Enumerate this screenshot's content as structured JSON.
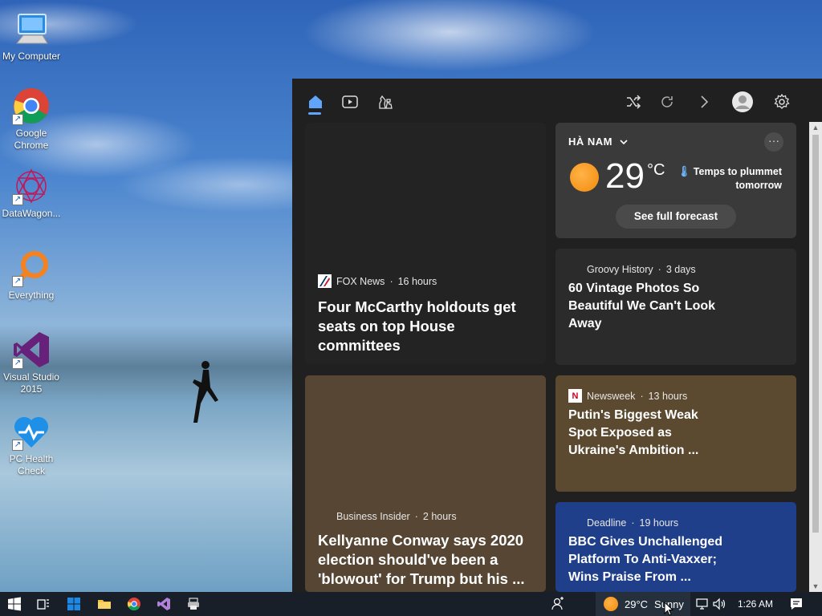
{
  "desktop": {
    "icons": [
      {
        "label": "My Computer",
        "icon": "computer-icon"
      },
      {
        "label": "Google Chrome",
        "icon": "chrome-icon"
      },
      {
        "label": "DataWagon...",
        "icon": "datawagon-icon"
      },
      {
        "label": "Everything",
        "icon": "everything-search-icon"
      },
      {
        "label": "Visual Studio 2015",
        "icon": "visual-studio-icon"
      },
      {
        "label": "PC Health Check",
        "icon": "pc-health-check-icon"
      }
    ]
  },
  "panel": {
    "toolbar": {
      "home": "home-icon",
      "video": "play-icon",
      "games": "chess-icon",
      "shuffle": "shuffle-icon",
      "refresh": "refresh-icon",
      "next": "chevron-right-icon",
      "profile": "avatar-icon",
      "settings": "gear-icon"
    },
    "weather": {
      "location": "HÀ NAM",
      "temp": "29",
      "unit": "°C",
      "note": "Temps to plummet tomorrow",
      "forecast_label": "See full forecast",
      "more": "···"
    },
    "cards": [
      {
        "source": "FOX News",
        "age": "16 hours",
        "title": "Four McCarthy holdouts get seats on top House committees"
      },
      {
        "source": "Groovy History",
        "age": "3 days",
        "title": "60 Vintage Photos So Beautiful We Can't Look Away"
      },
      {
        "source": "Newsweek",
        "age": "13 hours",
        "title": "Putin's Biggest Weak Spot Exposed as Ukraine's Ambition ..."
      },
      {
        "source": "Business Insider",
        "age": "2 hours",
        "title": "Kellyanne Conway says 2020 election should've been a 'blowout' for Trump but his ..."
      },
      {
        "source": "Deadline",
        "age": "19 hours",
        "title": "BBC Gives Unchallenged Platform To Anti-Vaxxer; Wins Praise From ..."
      }
    ],
    "separator": " · "
  },
  "taskbar": {
    "weather_temp": "29°C",
    "weather_cond": "Sunny",
    "time": "1:26 AM"
  }
}
